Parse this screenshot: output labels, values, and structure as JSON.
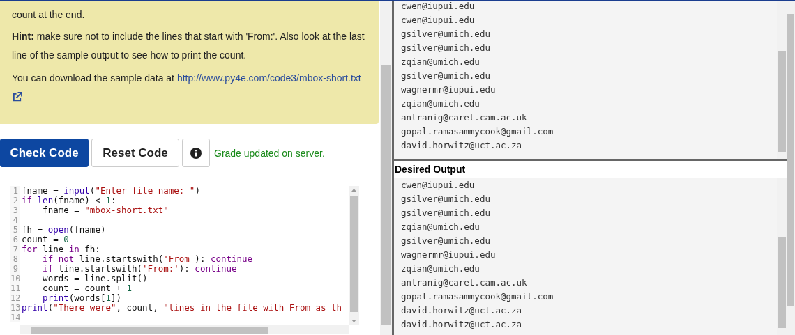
{
  "instructions": {
    "paragraphs": [
      "count at the end.",
      "**Hint:** make sure not to include the lines that start with 'From:'. Also look at the last line of the sample output to see how to print the count."
    ],
    "download_text": "You can download the sample data at",
    "link": "http://www.py4e.com/code3/mbox-short.txt"
  },
  "buttons": [
    {
      "label": "Check Code",
      "kind": "primary"
    },
    {
      "label": "Reset Code",
      "kind": "default"
    }
  ],
  "status": "Grade updated on server.",
  "editor": {
    "lines": [
      {
        "number": "1",
        "cursor": false,
        "tokens": [
          {
            "t": "fname = ",
            "kind": "plain"
          },
          {
            "t": "input",
            "kind": "builtin"
          },
          {
            "t": "(",
            "kind": "plain"
          },
          {
            "t": "\"Enter file name: \"",
            "kind": "string"
          },
          {
            "t": ")",
            "kind": "plain"
          }
        ]
      },
      {
        "number": "2",
        "cursor": false,
        "tokens": [
          {
            "t": "if",
            "kind": "keyword"
          },
          {
            "t": " len",
            "kind": "builtin"
          },
          {
            "t": "(fname) < ",
            "kind": "plain"
          },
          {
            "t": "1",
            "kind": "number"
          },
          {
            "t": ":",
            "kind": "plain"
          }
        ]
      },
      {
        "number": "3",
        "cursor": false,
        "tokens": [
          {
            "t": "    fname = ",
            "kind": "plain"
          },
          {
            "t": "\"mbox-short.txt\"",
            "kind": "string"
          }
        ]
      },
      {
        "number": "4",
        "cursor": false
      },
      {
        "number": "5",
        "cursor": false,
        "tokens": [
          {
            "t": "fh = ",
            "kind": "plain"
          },
          {
            "t": "open",
            "kind": "builtin"
          },
          {
            "t": "(fname)",
            "kind": "plain"
          }
        ]
      },
      {
        "number": "6",
        "cursor": false,
        "tokens": [
          {
            "t": "count = ",
            "kind": "plain"
          },
          {
            "t": "0",
            "kind": "number"
          }
        ]
      },
      {
        "number": "7",
        "cursor": false,
        "tokens": [
          {
            "t": "for",
            "kind": "keyword"
          },
          {
            "t": " line ",
            "kind": "plain"
          },
          {
            "t": "in",
            "kind": "keyword"
          },
          {
            "t": " fh:",
            "kind": "plain"
          }
        ]
      },
      {
        "number": "8",
        "cursor": true,
        "tokens": [
          {
            "t": "    if",
            "kind": "keyword"
          },
          {
            "t": " not",
            "kind": "keyword"
          },
          {
            "t": " line.startswith(",
            "kind": "plain"
          },
          {
            "t": "'From'",
            "kind": "string"
          },
          {
            "t": "): ",
            "kind": "plain"
          },
          {
            "t": "continue",
            "kind": "keyword"
          }
        ]
      },
      {
        "number": "9",
        "cursor": false,
        "tokens": [
          {
            "t": "    if",
            "kind": "keyword"
          },
          {
            "t": " line.startswith(",
            "kind": "plain"
          },
          {
            "t": "'From:'",
            "kind": "string"
          },
          {
            "t": "): ",
            "kind": "plain"
          },
          {
            "t": "continue",
            "kind": "keyword"
          }
        ]
      },
      {
        "number": "10",
        "cursor": false,
        "tokens": [
          {
            "t": "    words = line.split()",
            "kind": "plain"
          }
        ]
      },
      {
        "number": "11",
        "cursor": false,
        "tokens": [
          {
            "t": "    count = count + ",
            "kind": "plain"
          },
          {
            "t": "1",
            "kind": "number"
          }
        ]
      },
      {
        "number": "12",
        "cursor": false,
        "tokens": [
          {
            "t": "    print",
            "kind": "builtin"
          },
          {
            "t": "(words[",
            "kind": "plain"
          },
          {
            "t": "1",
            "kind": "number"
          },
          {
            "t": "])",
            "kind": "plain"
          }
        ]
      },
      {
        "number": "13",
        "cursor": false,
        "tokens": [
          {
            "t": "print",
            "kind": "builtin"
          },
          {
            "t": "(",
            "kind": "plain"
          },
          {
            "t": "\"There were\"",
            "kind": "string"
          },
          {
            "t": ", count, ",
            "kind": "plain"
          },
          {
            "t": "\"lines in the file with From as th",
            "kind": "string"
          }
        ]
      },
      {
        "number": "14",
        "cursor": false
      }
    ]
  },
  "output": {
    "lines": [
      "cwen@iupui.edu",
      "cwen@iupui.edu",
      "gsilver@umich.edu",
      "gsilver@umich.edu",
      "zqian@umich.edu",
      "gsilver@umich.edu",
      "wagnermr@iupui.edu",
      "zqian@umich.edu",
      "antranig@caret.cam.ac.uk",
      "gopal.ramasammycook@gmail.com",
      "david.horwitz@uct.ac.za"
    ]
  },
  "desired_output": {
    "title": "Desired Output",
    "lines": [
      "cwen@iupui.edu",
      "gsilver@umich.edu",
      "gsilver@umich.edu",
      "zqian@umich.edu",
      "gsilver@umich.edu",
      "wagnermr@iupui.edu",
      "zqian@umich.edu",
      "antranig@caret.cam.ac.uk",
      "gopal.ramasammycook@gmail.com",
      "david.horwitz@uct.ac.za",
      "david.horwitz@uct.ac.za"
    ]
  }
}
